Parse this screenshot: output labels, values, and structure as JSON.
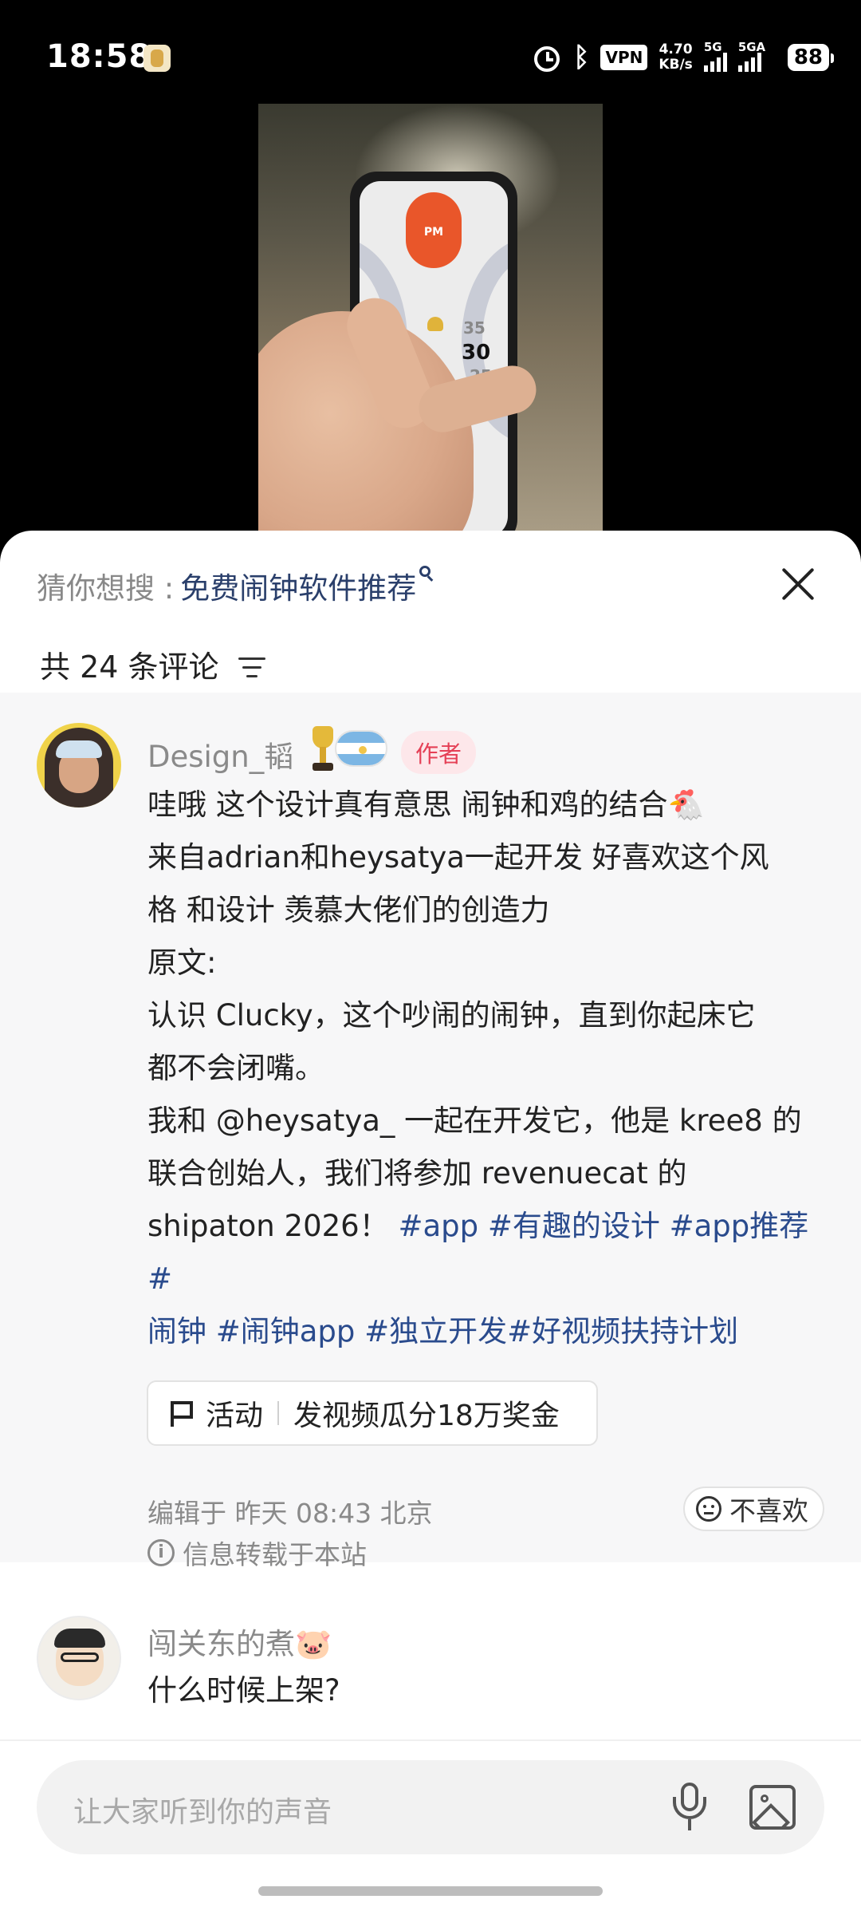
{
  "status_bar": {
    "time": "18:58",
    "vpn": "VPN",
    "net_speed_value": "4.70",
    "net_speed_unit": "KB/s",
    "signal1_label": "5G",
    "signal2_label": "5GA",
    "battery": "88"
  },
  "video": {
    "screen_pm_label": "PM",
    "dial_numbers": [
      "35",
      "30",
      "25"
    ]
  },
  "search_suggestion": {
    "prefix": "猜你想搜 :",
    "term": "免费闹钟软件推荐"
  },
  "comments_header": {
    "count_label": "共 24 条评论"
  },
  "author_comment": {
    "username": "Design_韬",
    "author_badge": "作者",
    "lines": [
      "哇哦 这个设计真有意思 闹钟和鸡的结合🐔",
      "来自adrian和heysatya一起开发 好喜欢这个风",
      "格 和设计 羡慕大佬们的创造力",
      "原文:",
      "认识 Clucky，这个吵闹的闹钟，直到你起床它",
      "都不会闭嘴。",
      "我和 @heysatya_ 一起在开发它，他是 kree8 的",
      "联合创始人，我们将参加 revenuecat 的"
    ],
    "line9_text": "shipaton 2026！",
    "line9_tags": " #app #有趣的设计 #app推荐 #",
    "line10_tags": "闹钟 #闹钟app #独立开发#好视频扶持计划",
    "activity_label": "活动",
    "activity_text": "发视频瓜分18万奖金",
    "edited": "编辑于  昨天 08:43  北京",
    "repost_info": "信息转载于本站",
    "dislike_label": "不喜欢"
  },
  "second_comment": {
    "username": "闯关东的煮🐷",
    "text": "什么时候上架?"
  },
  "input_bar": {
    "placeholder": "让大家听到你的声音"
  }
}
